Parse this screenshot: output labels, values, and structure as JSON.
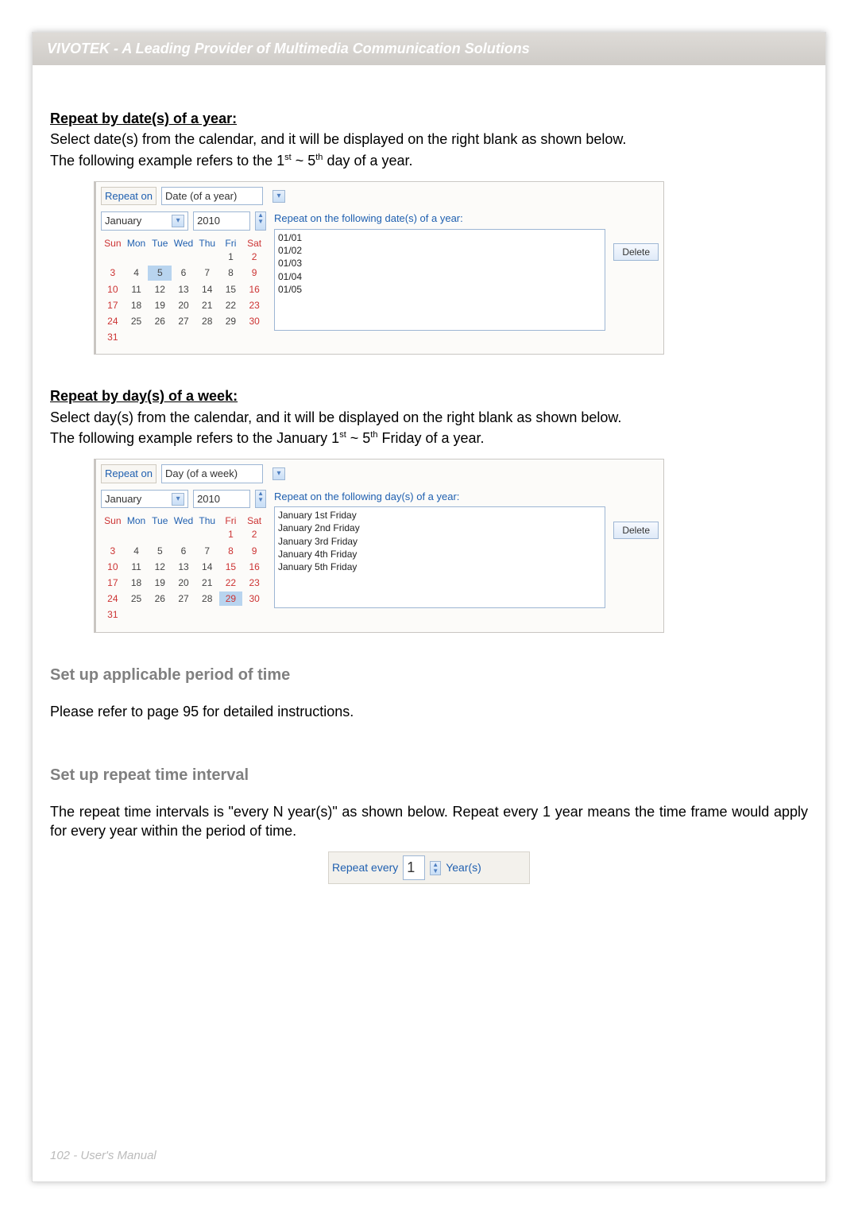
{
  "header": "VIVOTEK - A Leading Provider of Multimedia Communication Solutions",
  "sec1": {
    "title": "Repeat by date(s) of a year:",
    "p1": "Select date(s) from the calendar, and it will be displayed on the right blank as shown below.",
    "p2_a": "The following example refers to the 1",
    "p2_b": " ~ 5",
    "p2_c": " day of a year.",
    "sup1": "st",
    "sup2": "th"
  },
  "shot1": {
    "repeat_on": "Repeat on",
    "repeat_select": "Date (of a year)",
    "month": "January",
    "year": "2010",
    "weekdays": [
      "Sun",
      "Mon",
      "Tue",
      "Wed",
      "Thu",
      "Fri",
      "Sat"
    ],
    "result_label": "Repeat on the following date(s) of a year:",
    "results": [
      "01/01",
      "01/02",
      "01/03",
      "01/04",
      "01/05"
    ],
    "delete": "Delete"
  },
  "sec2": {
    "title": "Repeat by day(s) of a week:",
    "p1": "Select day(s) from the calendar, and it will be displayed on the right blank as shown below.",
    "p2_a": "The following example refers to the January 1",
    "p2_b": " ~ 5",
    "p2_c": " Friday of a year.",
    "sup1": "st",
    "sup2": "th"
  },
  "shot2": {
    "repeat_on": "Repeat on",
    "repeat_select": "Day (of a week)",
    "month": "January",
    "year": "2010",
    "weekdays": [
      "Sun",
      "Mon",
      "Tue",
      "Wed",
      "Thu",
      "Fri",
      "Sat"
    ],
    "result_label": "Repeat on the following day(s) of a year:",
    "results": [
      "January 1st Friday",
      "January 2nd Friday",
      "January 3rd Friday",
      "January 4th Friday",
      "January 5th Friday"
    ],
    "delete": "Delete"
  },
  "sec3": {
    "title": "Set up applicable period of time",
    "body": "Please refer to page 95 for detailed instructions."
  },
  "sec4": {
    "title": "Set up repeat time interval",
    "body": "The repeat time intervals is \"every N year(s)\" as shown below. Repeat every 1 year means the time frame would apply for every year within the period of time."
  },
  "shot3": {
    "label": "Repeat every",
    "value": "1",
    "unit": "Year(s)"
  },
  "footer": "102 - User's Manual"
}
